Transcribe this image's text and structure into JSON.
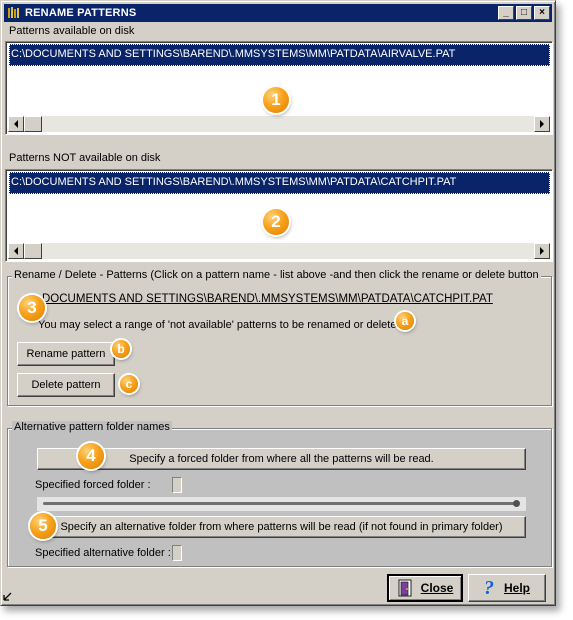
{
  "window": {
    "title": "RENAME PATTERNS",
    "controls": {
      "minimize": "_",
      "maximize": "□",
      "close": "×"
    }
  },
  "available": {
    "label": "Patterns available on disk",
    "items": [
      "C:\\DOCUMENTS AND SETTINGS\\BAREND\\.MMSYSTEMS\\MM\\PATDATA\\AIRVALVE.PAT"
    ]
  },
  "not_available": {
    "label": "Patterns NOT available on disk",
    "items": [
      "C:\\DOCUMENTS AND SETTINGS\\BAREND\\.MMSYSTEMS\\MM\\PATDATA\\CATCHPIT.PAT"
    ]
  },
  "rename_group": {
    "title": "Rename / Delete -  Patterns  (Click on a pattern name - list above -and then click the rename or delete button",
    "selected_path": "DOCUMENTS AND SETTINGS\\BAREND\\.MMSYSTEMS\\MM\\PATDATA\\CATCHPIT.PAT",
    "hint": "You may select a range of 'not available' patterns to be renamed or deleted",
    "rename_label": "Rename pattern",
    "delete_label": "Delete pattern"
  },
  "alt_group": {
    "title": "Alternative pattern folder names",
    "forced_button": "Specify a forced folder from where all the patterns will be read.",
    "forced_label": "Specified forced folder :",
    "alt_button": "Specify an alternative folder from where patterns will be read (if not found in primary folder)",
    "alt_label": "Specified alternative folder :"
  },
  "footer": {
    "close_label": "Close",
    "help_label": "Help"
  },
  "callouts": [
    "1",
    "2",
    "3",
    "4",
    "5",
    "a",
    "b",
    "c"
  ],
  "colors": {
    "titlebar": "#0a246a",
    "selection": "#0a246a",
    "callout": "#f7a21b",
    "face": "#d4d0c8"
  }
}
